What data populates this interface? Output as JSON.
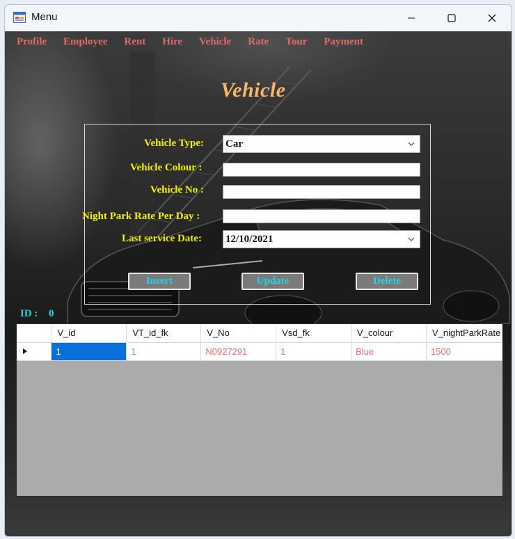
{
  "window": {
    "title": "Menu"
  },
  "menu": [
    "Profile",
    "Employee",
    "Rent",
    "Hire",
    "Vehicle",
    "Rate",
    "Tour",
    "Payment"
  ],
  "heading": "Vehicle",
  "form": {
    "vehicle_type_label": "Vehicle Type:",
    "vehicle_type_value": "Car",
    "vehicle_colour_label": "Vehicle Colour :",
    "vehicle_colour_value": "",
    "vehicle_no_label": "Vehicle No :",
    "vehicle_no_value": "",
    "night_park_label": "Night Park Rate Per Day :",
    "night_park_value": "",
    "last_service_label": "Last service Date:",
    "last_service_value": "12/10/2021"
  },
  "buttons": {
    "insert": "Insert",
    "update": "Update",
    "delete": "Delete"
  },
  "id": {
    "label": "ID :",
    "value": "0"
  },
  "grid": {
    "columns": [
      "V_id",
      "VT_id_fk",
      "V_No",
      "Vsd_fk",
      "V_colour",
      "V_nightParkRate"
    ],
    "rows": [
      [
        "1",
        "1",
        "N0927291",
        "1",
        "Blue",
        "1500"
      ]
    ]
  },
  "colors": {
    "menu_text": "#e06a6a",
    "label_text": "#f2f200",
    "button_text": "#23d3e6",
    "heading_text": "#f6b76b",
    "selected_cell": "#0a6fd8",
    "cell_text": "#ef6f6f"
  }
}
